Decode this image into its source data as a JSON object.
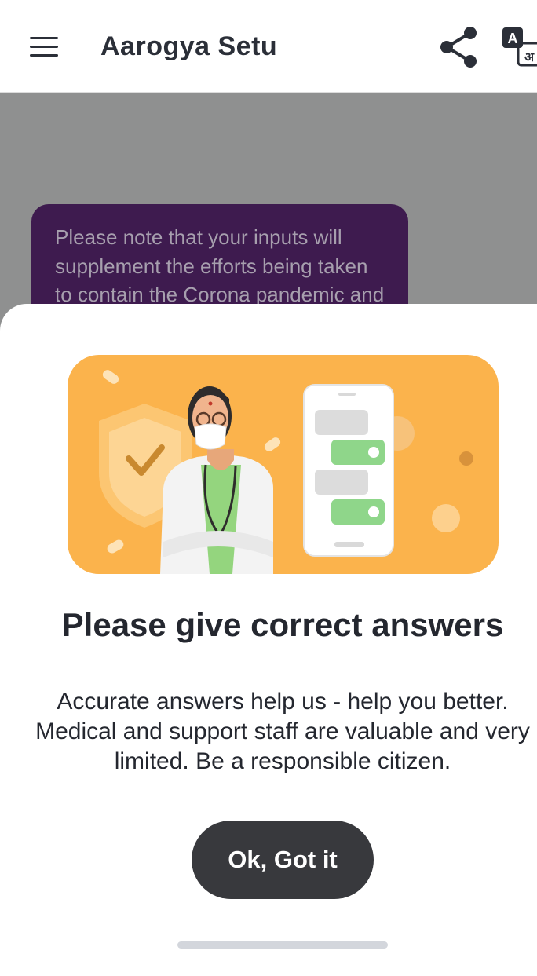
{
  "appbar": {
    "title": "Aarogya Setu",
    "menu_icon": "hamburger-menu-icon",
    "share_icon": "share-icon",
    "translate_icon": "translate-icon",
    "translate_badge_latin": "A",
    "translate_badge_devanagari": "अ"
  },
  "chat": {
    "message": "Please note that your inputs will supplement the efforts being taken to contain the Corona pandemic and assess the Vaccination status and symptoms. Please help"
  },
  "sheet": {
    "title": "Please give correct answers",
    "body": "Accurate answers help us - help you better. Medical and support staff are valuable and very limited. Be a responsible citizen.",
    "ok_label": "Ok, Got it",
    "illustration": "doctor-with-phone-chat-illustration"
  },
  "colors": {
    "appbar_bg": "#ffffff",
    "scrim": "#8f9090",
    "chat_bubble": "#3e1b4f",
    "illustration_bg": "#fbb34c",
    "button_bg": "#38393d",
    "title_text": "#24272f"
  }
}
